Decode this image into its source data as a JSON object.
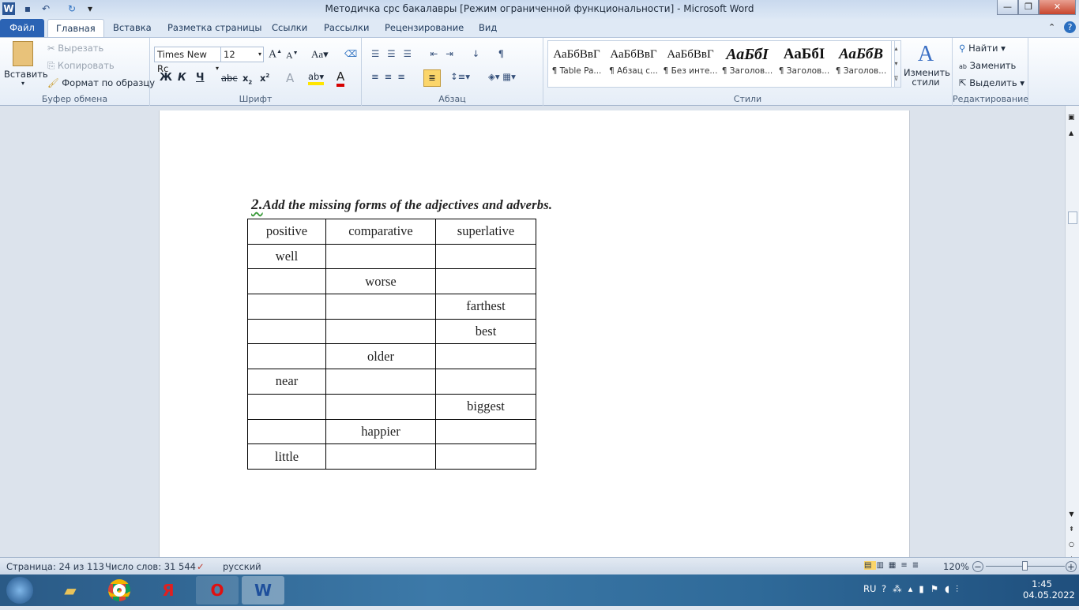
{
  "window": {
    "title": "Методичка срс бакалавры [Режим ограниченной функциональности]  -  Microsoft Word"
  },
  "tabs": [
    {
      "label": "Файл"
    },
    {
      "label": "Главная"
    },
    {
      "label": "Вставка"
    },
    {
      "label": "Разметка страницы"
    },
    {
      "label": "Ссылки"
    },
    {
      "label": "Рассылки"
    },
    {
      "label": "Рецензирование"
    },
    {
      "label": "Вид"
    }
  ],
  "clipboard": {
    "paste": "Вставить",
    "cut": "Вырезать",
    "copy": "Копировать",
    "format_painter": "Формат по образцу",
    "label": "Буфер обмена"
  },
  "font": {
    "name": "Times New Rc",
    "size": "12",
    "label": "Шрифт",
    "bold": "Ж",
    "italic": "К",
    "underline": "Ч",
    "case": "Aa"
  },
  "paragraph": {
    "label": "Абзац"
  },
  "styles": {
    "label": "Стили",
    "change": "Изменить стили",
    "items": [
      {
        "preview": "АаБбВвГ",
        "name": "¶ Table Pa..."
      },
      {
        "preview": "АаБбВвГ",
        "name": "¶ Абзац с..."
      },
      {
        "preview": "АаБбВвГ",
        "name": "¶ Без инте..."
      },
      {
        "preview": "АаБбІ",
        "name": "¶ Заголов..."
      },
      {
        "preview": "АаБбІ",
        "name": "¶ Заголов..."
      },
      {
        "preview": "АаБбВ",
        "name": "¶ Заголов..."
      }
    ]
  },
  "editing": {
    "label": "Редактирование",
    "find": "Найти",
    "replace": "Заменить",
    "select": "Выделить"
  },
  "document": {
    "heading_num": "2.",
    "heading": "Add the missing forms of the adjectives and adverbs.",
    "table": {
      "headers": [
        "positive",
        "comparative",
        "superlative"
      ],
      "rows": [
        [
          "well",
          "",
          ""
        ],
        [
          "",
          "worse",
          ""
        ],
        [
          "",
          "",
          "farthest"
        ],
        [
          "",
          "",
          "best"
        ],
        [
          "",
          "older",
          ""
        ],
        [
          "near",
          "",
          ""
        ],
        [
          "",
          "",
          "biggest"
        ],
        [
          "",
          "happier",
          ""
        ],
        [
          "little",
          "",
          ""
        ]
      ]
    }
  },
  "status": {
    "page": "Страница: 24 из 113",
    "words": "Число слов: 31 544",
    "language": "русский",
    "zoom": "120%"
  },
  "tray": {
    "lang": "RU",
    "time": "1:45",
    "date": "04.05.2022"
  }
}
